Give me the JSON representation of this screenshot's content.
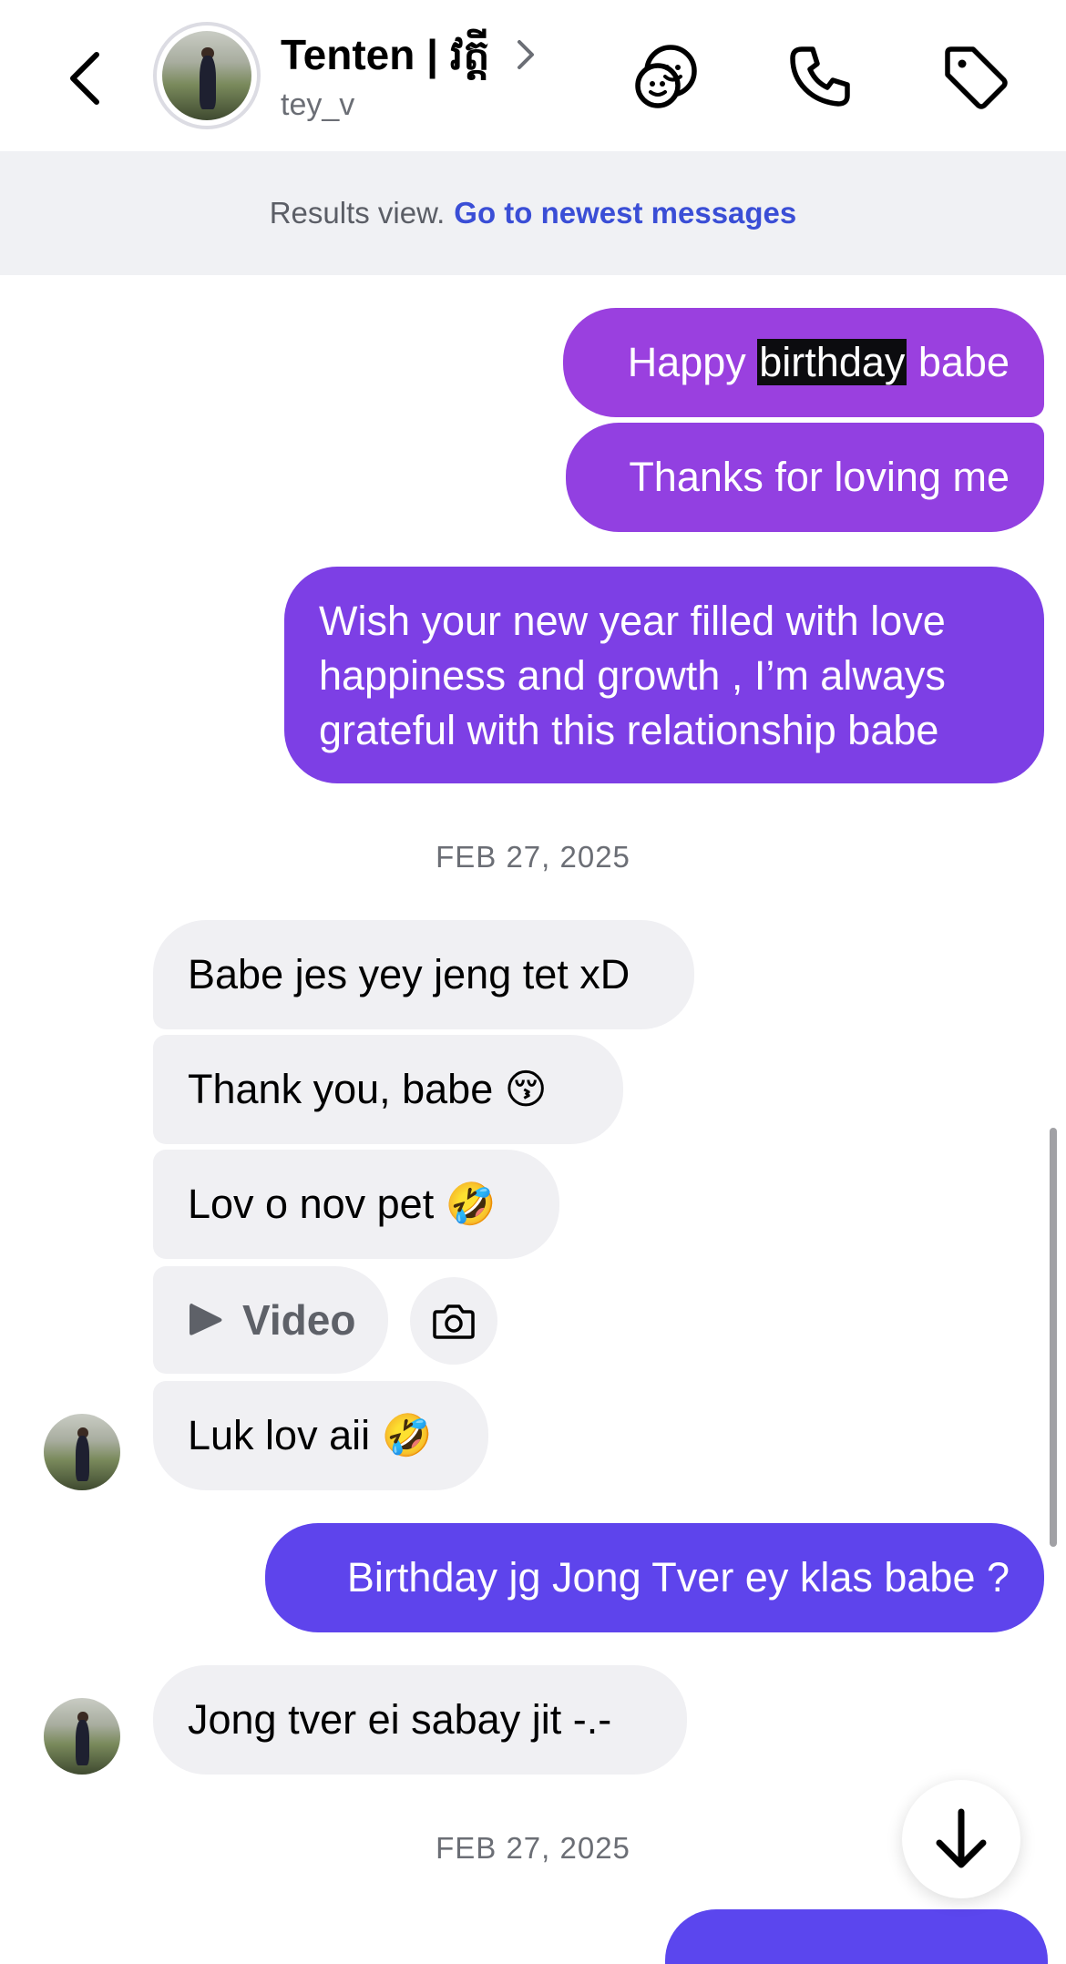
{
  "header": {
    "name": "Tenten | វត្តី",
    "username": "tey_v"
  },
  "banner": {
    "prefix": "Results view.",
    "link": "Go to newest messages"
  },
  "messages": {
    "m1_before": "Happy ",
    "m1_highlight": "birthday",
    "m1_after": " babe",
    "m2": "Thanks for loving me",
    "m3_line1": "Wish your new year filled with love",
    "m3_line2": "happiness and growth , I’m always",
    "m3_line3": "grateful with this relationship babe",
    "date1": "FEB 27, 2025",
    "r1": "Babe jes yey jeng tet xD",
    "r2_text": "Thank you, babe ",
    "r2_emoji": "😚",
    "r3_text": "Lov o nov pet ",
    "r3_emoji": "🤣",
    "video_label": "Video",
    "r4_text": "Luk lov aii ",
    "r4_emoji": "🤣",
    "m4": "Birthday jg Jong Tver ey klas babe ?",
    "r5": "Jong tver ei sabay jit -.-",
    "date2": "FEB 27, 2025"
  },
  "colors": {
    "bubble_purple_top": "#9a3fe0",
    "bubble_purple_mid": "#7a3fe6",
    "bubble_indigo": "#5e44ec",
    "received_bg": "#f0f0f3",
    "link": "#3a4ed6"
  },
  "icons": {
    "back": "chevron-left-icon",
    "theme": "sticker-faces-icon",
    "call": "phone-icon",
    "tag": "tag-icon",
    "video": "play-icon",
    "camera": "camera-icon",
    "scroll_down": "arrow-down-icon"
  }
}
